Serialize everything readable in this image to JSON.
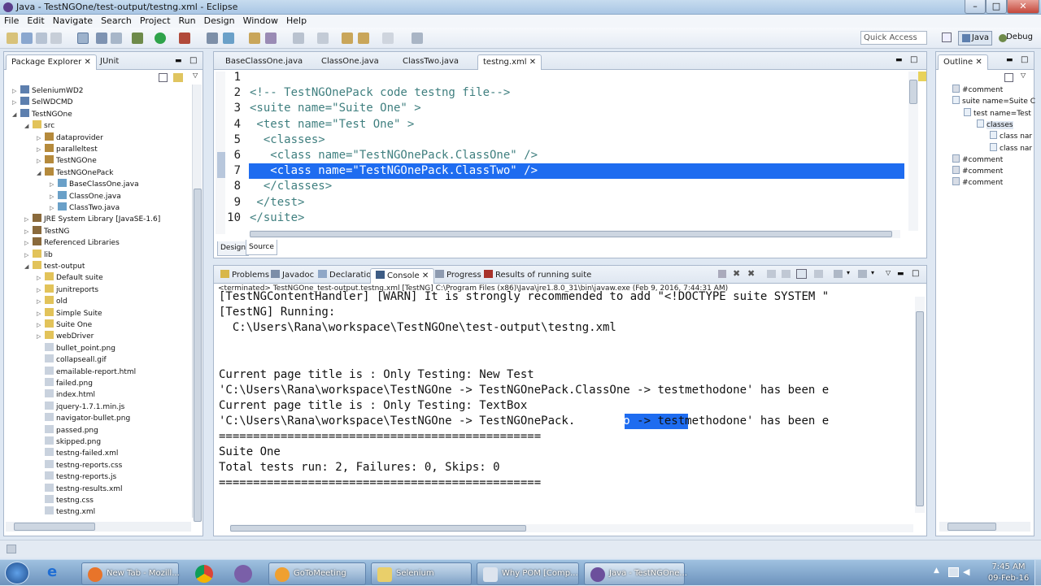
{
  "window": {
    "title": "Java - TestNGOne/test-output/testng.xml - Eclipse",
    "minimize": "–",
    "maximize": "□",
    "close": "✕"
  },
  "menu": [
    "File",
    "Edit",
    "Navigate",
    "Search",
    "Project",
    "Run",
    "Design",
    "Window",
    "Help"
  ],
  "toolbar": {
    "quick_access": "Quick Access",
    "perspective_java": "Java",
    "perspective_debug": "Debug"
  },
  "explorer": {
    "tabs": [
      "Package Explorer",
      "JUnit"
    ],
    "items": [
      {
        "label": "SeleniumWD2",
        "icon": "project",
        "arrow": "▷"
      },
      {
        "label": "SelWDCMD",
        "icon": "project",
        "arrow": "▷"
      },
      {
        "label": "TestNGOne",
        "icon": "project",
        "arrow": "◢"
      },
      {
        "label": "src",
        "icon": "folder",
        "arrow": "◢"
      },
      {
        "label": "dataprovider",
        "icon": "package",
        "arrow": "▷"
      },
      {
        "label": "paralleltest",
        "icon": "package",
        "arrow": "▷"
      },
      {
        "label": "TestNGOne",
        "icon": "package",
        "arrow": "▷"
      },
      {
        "label": "TestNGOnePack",
        "icon": "package",
        "arrow": "◢"
      },
      {
        "label": "BaseClassOne.java",
        "icon": "java",
        "arrow": "▷"
      },
      {
        "label": "ClassOne.java",
        "icon": "java",
        "arrow": "▷"
      },
      {
        "label": "ClassTwo.java",
        "icon": "java",
        "arrow": "▷"
      },
      {
        "label": "JRE System Library [JavaSE-1.6]",
        "icon": "library",
        "arrow": "▷"
      },
      {
        "label": "TestNG",
        "icon": "library",
        "arrow": "▷"
      },
      {
        "label": "Referenced Libraries",
        "icon": "library",
        "arrow": "▷"
      },
      {
        "label": "lib",
        "icon": "folder",
        "arrow": "▷"
      },
      {
        "label": "test-output",
        "icon": "folder",
        "arrow": "◢"
      },
      {
        "label": "Default suite",
        "icon": "folder",
        "arrow": "▷"
      },
      {
        "label": "junitreports",
        "icon": "folder",
        "arrow": "▷"
      },
      {
        "label": "old",
        "icon": "folder",
        "arrow": "▷"
      },
      {
        "label": "Simple Suite",
        "icon": "folder",
        "arrow": "▷"
      },
      {
        "label": "Suite One",
        "icon": "folder",
        "arrow": "▷"
      },
      {
        "label": "webDriver",
        "icon": "folder",
        "arrow": "▷"
      },
      {
        "label": "bullet_point.png",
        "icon": "file",
        "arrow": ""
      },
      {
        "label": "collapseall.gif",
        "icon": "file",
        "arrow": ""
      },
      {
        "label": "emailable-report.html",
        "icon": "file",
        "arrow": ""
      },
      {
        "label": "failed.png",
        "icon": "file",
        "arrow": ""
      },
      {
        "label": "index.html",
        "icon": "file",
        "arrow": ""
      },
      {
        "label": "jquery-1.7.1.min.js",
        "icon": "file",
        "arrow": ""
      },
      {
        "label": "navigator-bullet.png",
        "icon": "file",
        "arrow": ""
      },
      {
        "label": "passed.png",
        "icon": "file",
        "arrow": ""
      },
      {
        "label": "skipped.png",
        "icon": "file",
        "arrow": ""
      },
      {
        "label": "testng-failed.xml",
        "icon": "file",
        "arrow": ""
      },
      {
        "label": "testng-reports.css",
        "icon": "file",
        "arrow": ""
      },
      {
        "label": "testng-reports.js",
        "icon": "file",
        "arrow": ""
      },
      {
        "label": "testng-results.xml",
        "icon": "file",
        "arrow": ""
      },
      {
        "label": "testng.css",
        "icon": "file",
        "arrow": ""
      },
      {
        "label": "testng.xml",
        "icon": "file",
        "arrow": ""
      }
    ]
  },
  "editor": {
    "tabs": [
      "BaseClassOne.java",
      "ClassOne.java",
      "ClassTwo.java",
      "testng.xml"
    ],
    "lines": [
      {
        "num": "1",
        "text": ""
      },
      {
        "num": "2",
        "text": "<!-- TestNGOnePack code testng file-->"
      },
      {
        "num": "3",
        "text": "<suite name=\"Suite One\" >"
      },
      {
        "num": "4",
        "text": " <test name=\"Test One\" >"
      },
      {
        "num": "5",
        "text": "  <classes>"
      },
      {
        "num": "6",
        "text": "   <class name=\"TestNGOnePack.ClassOne\" />"
      },
      {
        "num": "7",
        "text": "   <class name=\"TestNGOnePack.ClassTwo\" />"
      },
      {
        "num": "8",
        "text": "  </classes>"
      },
      {
        "num": "9",
        "text": " </test>"
      },
      {
        "num": "10",
        "text": "</suite>"
      }
    ],
    "bottom_tabs": [
      "Design",
      "Source"
    ]
  },
  "outline": {
    "tab": "Outline",
    "items": [
      "#comment",
      "suite name=Suite C",
      "test name=Test",
      "classes",
      "class nar",
      "class nar",
      "#comment",
      "#comment",
      "#comment"
    ]
  },
  "console": {
    "tabs": [
      "Problems",
      "Javadoc",
      "Declaration",
      "Console",
      "Progress",
      "Results of running suite"
    ],
    "status": "<terminated> TestNGOne_test-output.testng.xml [TestNG] C:\\Program Files (x86)\\Java\\jre1.8.0_31\\bin\\javaw.exe (Feb 9, 2016, 7:44:31 AM)",
    "lines": [
      "[TestNGContentHandler] [WARN] It is strongly recommended to add \"<!DOCTYPE suite SYSTEM \"",
      "[TestNG] Running:",
      "  C:\\Users\\Rana\\workspace\\TestNGOne\\test-output\\testng.xml",
      "",
      "",
      "Current page title is : Only Testing: New Test",
      "'C:\\Users\\Rana\\workspace\\TestNGOne -> TestNGOnePack.ClassOne -> testmethodone' has been e",
      "Current page title is : Only Testing: TextBox",
      "'C:\\Users\\Rana\\workspace\\TestNGOne -> TestNGOnePack.ClassTwo -> testmethodone' has been e",
      "===============================================",
      "Suite One",
      "Total tests run: 2, Failures: 0, Skips: 0",
      "==============================================="
    ],
    "selected_word": "ClassTwo"
  },
  "taskbar": {
    "tasks": [
      "New Tab - Mozill...",
      "GoToMeeting",
      "Selenium",
      "Why POM [Comp...",
      "Java - TestNGOne..."
    ],
    "time": "7:45 AM",
    "date": "09-Feb-16"
  },
  "colors": {
    "selection": "#1e6cf0",
    "string": "#2a00ff",
    "tag": "#3f7f7f"
  }
}
